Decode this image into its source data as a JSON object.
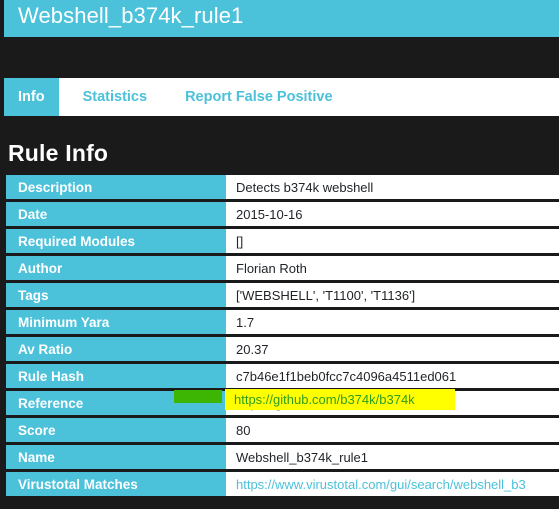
{
  "header": {
    "title": "Webshell_b374k_rule1"
  },
  "tabs": [
    {
      "label": "Info",
      "active": true
    },
    {
      "label": "Statistics",
      "active": false
    },
    {
      "label": "Report False Positive",
      "active": false
    }
  ],
  "section": {
    "title": "Rule Info"
  },
  "table": {
    "rows": [
      {
        "key": "Description",
        "value": "Detects b374k webshell"
      },
      {
        "key": "Date",
        "value": "2015-10-16"
      },
      {
        "key": "Required Modules",
        "value": "[]"
      },
      {
        "key": "Author",
        "value": "Florian Roth"
      },
      {
        "key": "Tags",
        "value": "['WEBSHELL', 'T1100', 'T1136']"
      },
      {
        "key": "Minimum Yara",
        "value": "1.7"
      },
      {
        "key": "Av Ratio",
        "value": "20.37"
      },
      {
        "key": "Rule Hash",
        "value": "c7b46e1f1beb0fcc7c4096a4511ed061"
      },
      {
        "key": "Reference",
        "value": "https://github.com/b374k/b374k"
      },
      {
        "key": "Score",
        "value": "80"
      },
      {
        "key": "Name",
        "value": "Webshell_b374k_rule1"
      },
      {
        "key": "Virustotal Matches",
        "value": "https://www.virustotal.com/gui/search/webshell_b3"
      }
    ]
  },
  "annotations": {
    "reference_highlight_text": "https://github.com/b374k/b374k"
  },
  "colors": {
    "accent": "#4bc1da",
    "background": "#1a1a1a",
    "highlight_yellow": "#ffff00",
    "highlight_green": "#3cb503",
    "link_green": "#2e9e1e"
  }
}
